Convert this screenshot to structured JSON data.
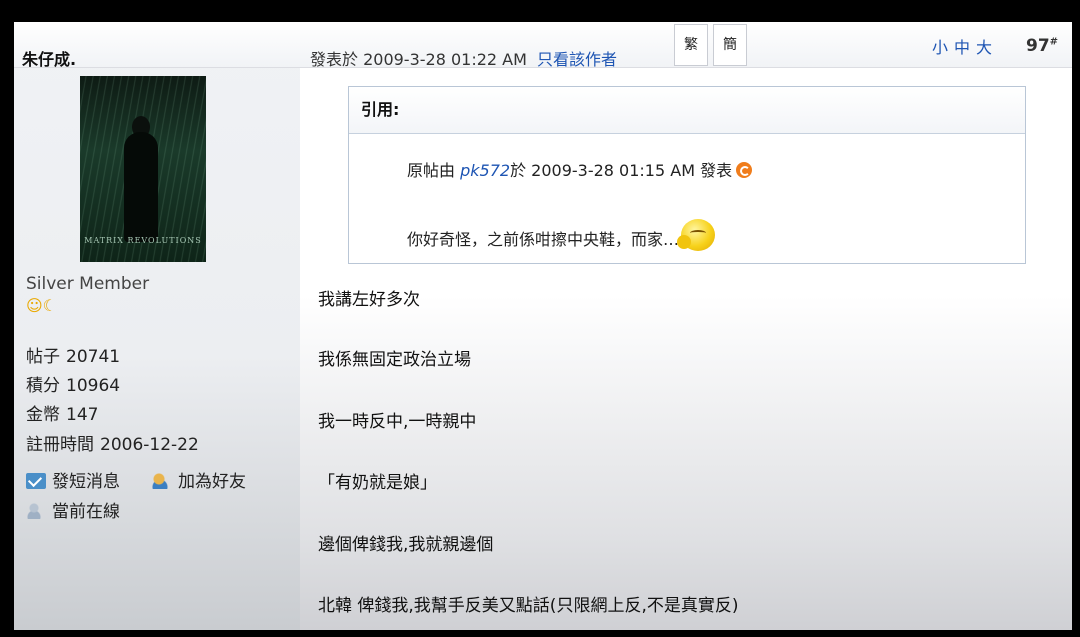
{
  "sidebar": {
    "username": "朱仔成.",
    "avatar_caption": "MATRIX REVOLUTIONS",
    "rank": "Silver Member",
    "rank_icons": "☺☾",
    "stats": [
      {
        "label": "帖子",
        "value": "20741"
      },
      {
        "label": "積分",
        "value": "10964"
      },
      {
        "label": "金幣",
        "value": "147"
      },
      {
        "label": "註冊時間",
        "value": "2006-12-22"
      }
    ],
    "actions": {
      "send_pm": "發短消息",
      "add_friend": "加為好友",
      "online": "當前在線"
    }
  },
  "header": {
    "posted_at": "發表於 2009-3-28 01:22 AM",
    "only_author": "只看該作者",
    "traditional": "繁",
    "simplified": "簡",
    "font_sizes": "小中大",
    "floor": "97",
    "floor_mark": "#"
  },
  "quote": {
    "title": "引用:",
    "meta_prefix": "原帖由",
    "meta_user": "pk572",
    "meta_suffix": "於 2009-3-28 01:15 AM 發表",
    "text": "你好奇怪，之前係咁擦中央鞋，而家…"
  },
  "post_lines": [
    "我講左好多次",
    "我係無固定政治立場",
    "我一時反中,一時親中",
    "「有奶就是娘」",
    "邊個俾錢我,我就親邊個",
    "北韓 俾錢我,我幫手反美又點話(只限網上反,不是真實反)"
  ]
}
